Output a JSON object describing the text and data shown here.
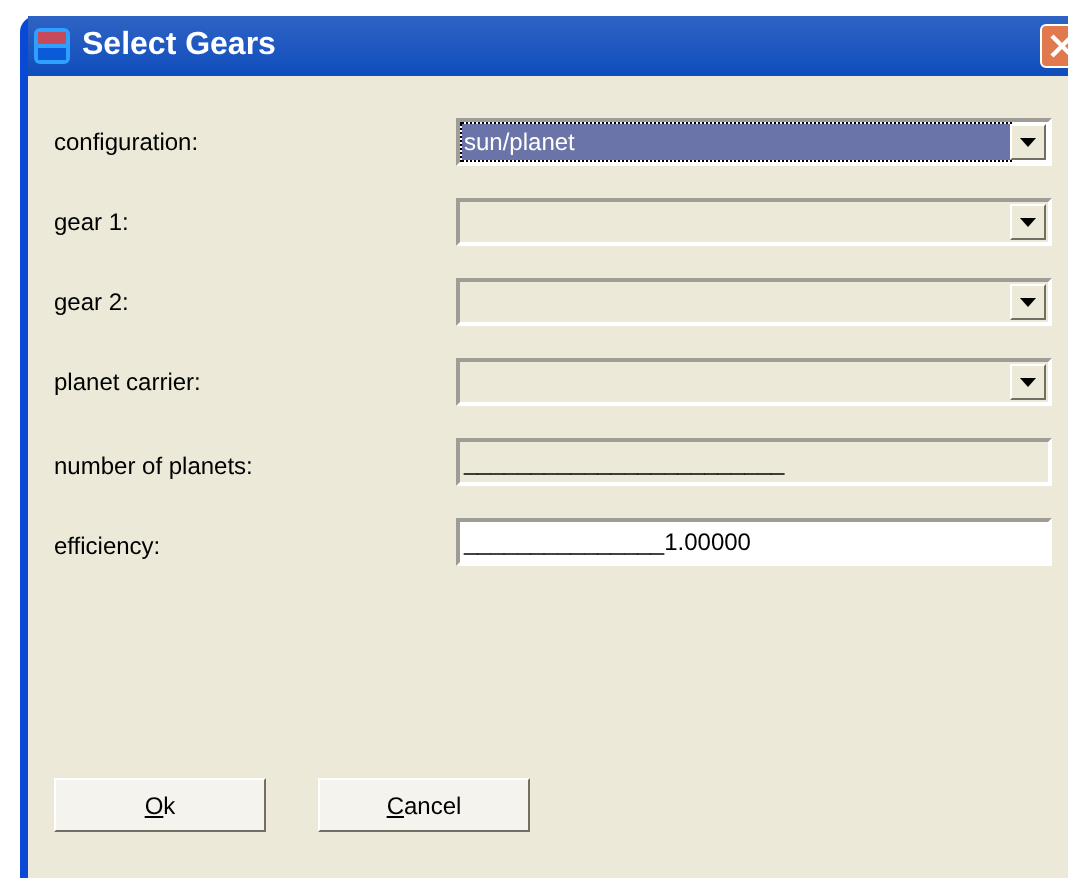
{
  "window": {
    "title": "Select Gears"
  },
  "fields": [
    {
      "label": "configuration:",
      "kind": "combo",
      "value": "sun/planet",
      "disabled": false,
      "focused": true
    },
    {
      "label": "gear 1:",
      "kind": "combo",
      "disabled": true,
      "focused": false
    },
    {
      "label": "gear 2:",
      "kind": "combo",
      "disabled": true,
      "focused": false
    },
    {
      "label": "planet carrier:",
      "kind": "combo",
      "disabled": true,
      "focused": false
    },
    {
      "label": "number of planets:",
      "kind": "text",
      "value": "________________________",
      "disabled": true,
      "focused": false
    },
    {
      "label": "efficiency:",
      "kind": "text",
      "value": "_______________1.00000",
      "disabled": false,
      "focused": false
    }
  ],
  "buttons": [
    {
      "label": "Ok",
      "mnemonic_underlined": true
    },
    {
      "label": "Cancel",
      "mnemonic_underlined": true
    }
  ]
}
